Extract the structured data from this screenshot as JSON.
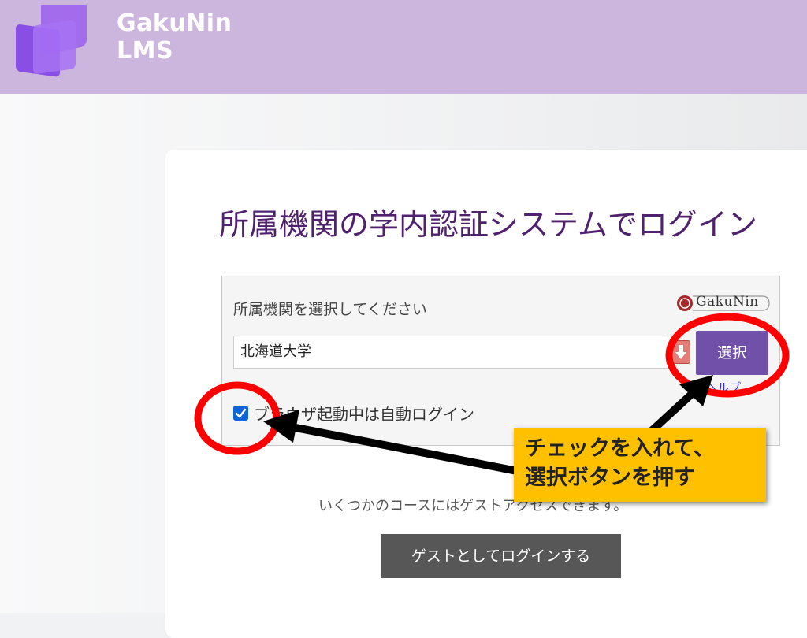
{
  "header": {
    "brand_line1": "GakuNin",
    "brand_line2": "LMS",
    "background_color": "#cdb6dd"
  },
  "login": {
    "title": "所属機関の学内認証システムでログイン",
    "idp_label": "所属機関を選択してください",
    "idp_logo_text": "GakuNin",
    "idp_input_value": "北海道大学",
    "select_button_label": "選択",
    "remember_checked": true,
    "remember_label": "ブラウザ起動中は自動ログイン",
    "help_link_text": "ヘルプ"
  },
  "guest": {
    "info_text": "いくつかのコースにはゲストアクセスできます。",
    "button_label": "ゲストとしてログインする"
  },
  "annotation": {
    "callout_line1": "チェックを入れて、",
    "callout_line2": "選択ボタンを押す",
    "callout_color": "#ffc000",
    "circle_color": "#ff0000",
    "arrow_color": "#000000"
  },
  "icons": {
    "brand_logo": "gakunin-lms-logo-icon",
    "dropdown": "arrow-down-icon",
    "checkbox": "checkmark-icon",
    "gakunin_emblem": "gakunin-emblem-icon"
  },
  "colors": {
    "title": "#50226e",
    "select_button": "#7050a8",
    "guest_button": "#575757",
    "checkbox": "#0d63d8"
  }
}
